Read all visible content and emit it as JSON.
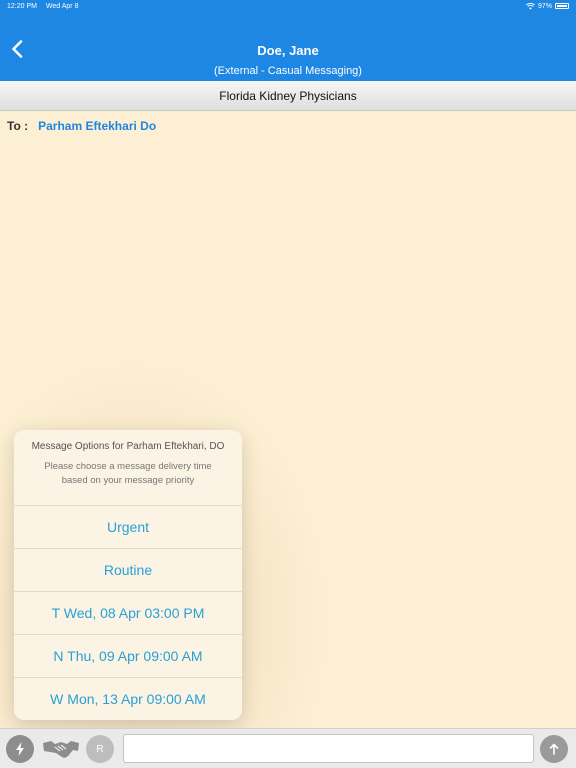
{
  "status_bar": {
    "time": "12:20 PM",
    "date": "Wed Apr 8",
    "battery": "97%"
  },
  "header": {
    "title": "Doe, Jane",
    "subtitle": "(External - Casual Messaging)"
  },
  "organization": "Florida Kidney Physicians",
  "recipient": {
    "label": "To :",
    "name": "Parham Eftekhari Do"
  },
  "popover": {
    "title": "Message Options for Parham Eftekhari, DO",
    "message": "Please choose a message delivery time based on your message priority",
    "options": [
      "Urgent",
      "Routine",
      "T Wed, 08 Apr 03:00 PM",
      "N Thu, 09 Apr 09:00 AM",
      "W Mon, 13 Apr 09:00 AM"
    ]
  },
  "toolbar": {
    "r_label": "R",
    "input_value": ""
  },
  "icons": [
    "wifi-icon",
    "battery-icon",
    "back-chevron-icon",
    "flash-icon",
    "handshake-icon",
    "send-arrow-icon"
  ],
  "colors": {
    "primary": "#1e86e3",
    "background": "#fdefd3",
    "option_text": "#2a9fd6"
  }
}
